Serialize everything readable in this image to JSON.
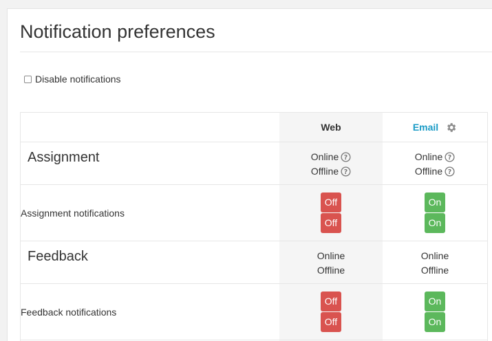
{
  "page": {
    "title": "Notification preferences",
    "disable_label": "Disable notifications"
  },
  "table": {
    "processors": [
      {
        "label": "Web"
      },
      {
        "label": "Email"
      }
    ],
    "components": [
      {
        "name": "Assignment",
        "web_states": [
          "Online",
          "Offline"
        ],
        "email_states": [
          "Online",
          "Offline"
        ],
        "preference": {
          "label": "Assignment notifications",
          "web": [
            "Off",
            "Off"
          ],
          "email": [
            "On",
            "On"
          ]
        }
      },
      {
        "name": "Feedback",
        "web_states": [
          "Online",
          "Offline"
        ],
        "email_states": [
          "Online",
          "Offline"
        ],
        "preference": {
          "label": "Feedback notifications",
          "web": [
            "Off",
            "Off"
          ],
          "email": [
            "On",
            "On"
          ]
        }
      }
    ]
  },
  "colors": {
    "off": "#d9534f",
    "on": "#5cb85c",
    "email_header": "#1a9bc6"
  },
  "icons": {
    "gear": "gear-icon",
    "help": "question-circle-icon"
  }
}
